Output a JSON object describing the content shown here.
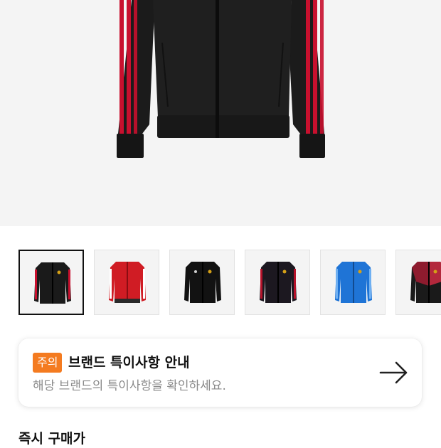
{
  "product": {
    "main_image": "black-red-track-jacket",
    "thumbnails": [
      {
        "icon": "black-red-stripe-jacket",
        "selected": true
      },
      {
        "icon": "red-jacket",
        "selected": false
      },
      {
        "icon": "black-jacket",
        "selected": false
      },
      {
        "icon": "black-red-jacket",
        "selected": false
      },
      {
        "icon": "blue-jacket",
        "selected": false
      },
      {
        "icon": "black-red-pattern-jacket",
        "selected": false
      }
    ]
  },
  "notice": {
    "badge": "주의",
    "title": "브랜드 특이사항 안내",
    "description": "해당 브랜드의 특이사항을 확인하세요.",
    "arrow_icon": "arrow-right-icon",
    "badge_color": "#f47b20"
  },
  "price_section": {
    "title": "즉시 구매가"
  }
}
